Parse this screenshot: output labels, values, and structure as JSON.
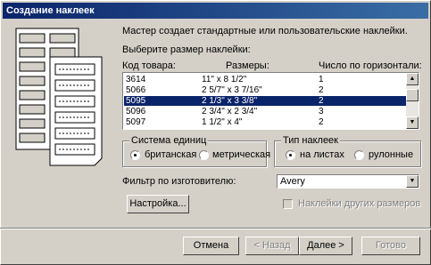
{
  "window": {
    "title": "Создание наклеек"
  },
  "intro": "Мастер создает стандартные или пользовательские наклейки.",
  "choose_size": "Выберите размер наклейки:",
  "columns": [
    "Код товара:",
    "Размеры:",
    "Число по горизонтали:"
  ],
  "rows": [
    [
      "3614",
      "11\" x 8 1/2\"",
      "1"
    ],
    [
      "5066",
      "2 5/7\" x 3 7/16\"",
      "2"
    ],
    [
      "5095",
      "2 1/3\" x 3 3/8\"",
      "2"
    ],
    [
      "5096",
      "2 3/4\" x 2 3/4\"",
      "3"
    ],
    [
      "5097",
      "1 1/2\" x 4\"",
      "2"
    ]
  ],
  "selected_row": 2,
  "units_group": {
    "title": "Система единиц",
    "options": [
      "британская",
      "метрическая"
    ],
    "selected": 0
  },
  "type_group": {
    "title": "Тип наклеек",
    "options": [
      "на листах",
      "рулонные"
    ],
    "selected": 0
  },
  "filter": {
    "label": "Фильтр по изготовителю:",
    "value": "Avery"
  },
  "custom_button": "Настройка...",
  "other_sizes_checkbox": "Наклейки других размеров",
  "buttons": {
    "cancel": "Отмена",
    "back": "< Назад",
    "next": "Далее >",
    "finish": "Готово"
  }
}
